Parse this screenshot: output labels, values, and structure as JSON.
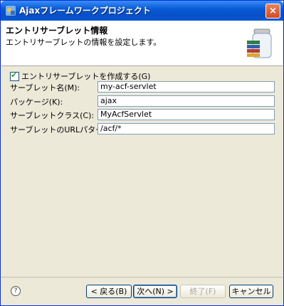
{
  "window": {
    "title": "Ajaxフレームワークプロジェクト",
    "close_label": "×"
  },
  "banner": {
    "title": "エントリサーブレット情報",
    "description": "エントリサーブレットの情報を設定します。"
  },
  "form": {
    "create_checkbox": {
      "label": "エントリサーブレットを作成する(G)",
      "checked": true,
      "mark": "✔"
    },
    "fields": [
      {
        "label": "サーブレット名(M):",
        "value": "my-acf-servlet"
      },
      {
        "label": "パッケージ(K):",
        "value": "ajax"
      },
      {
        "label": "サーブレットクラス(C):",
        "value": "MyAcfServlet"
      },
      {
        "label": "サーブレットのURLパターン(P):",
        "value": "/acf/*"
      }
    ]
  },
  "footer": {
    "help_icon": "?",
    "back_label": "< 戻る(B)",
    "next_label": "次へ(N) >",
    "finish_label": "終了(F)",
    "cancel_label": "キャンセル"
  },
  "icons": {
    "app": "app-icon",
    "wizard": "servlet-jar-icon",
    "help": "help-icon"
  },
  "colors": {
    "titlebar": "#0a5cd6",
    "close": "#d44b21",
    "check": "#21a121"
  }
}
